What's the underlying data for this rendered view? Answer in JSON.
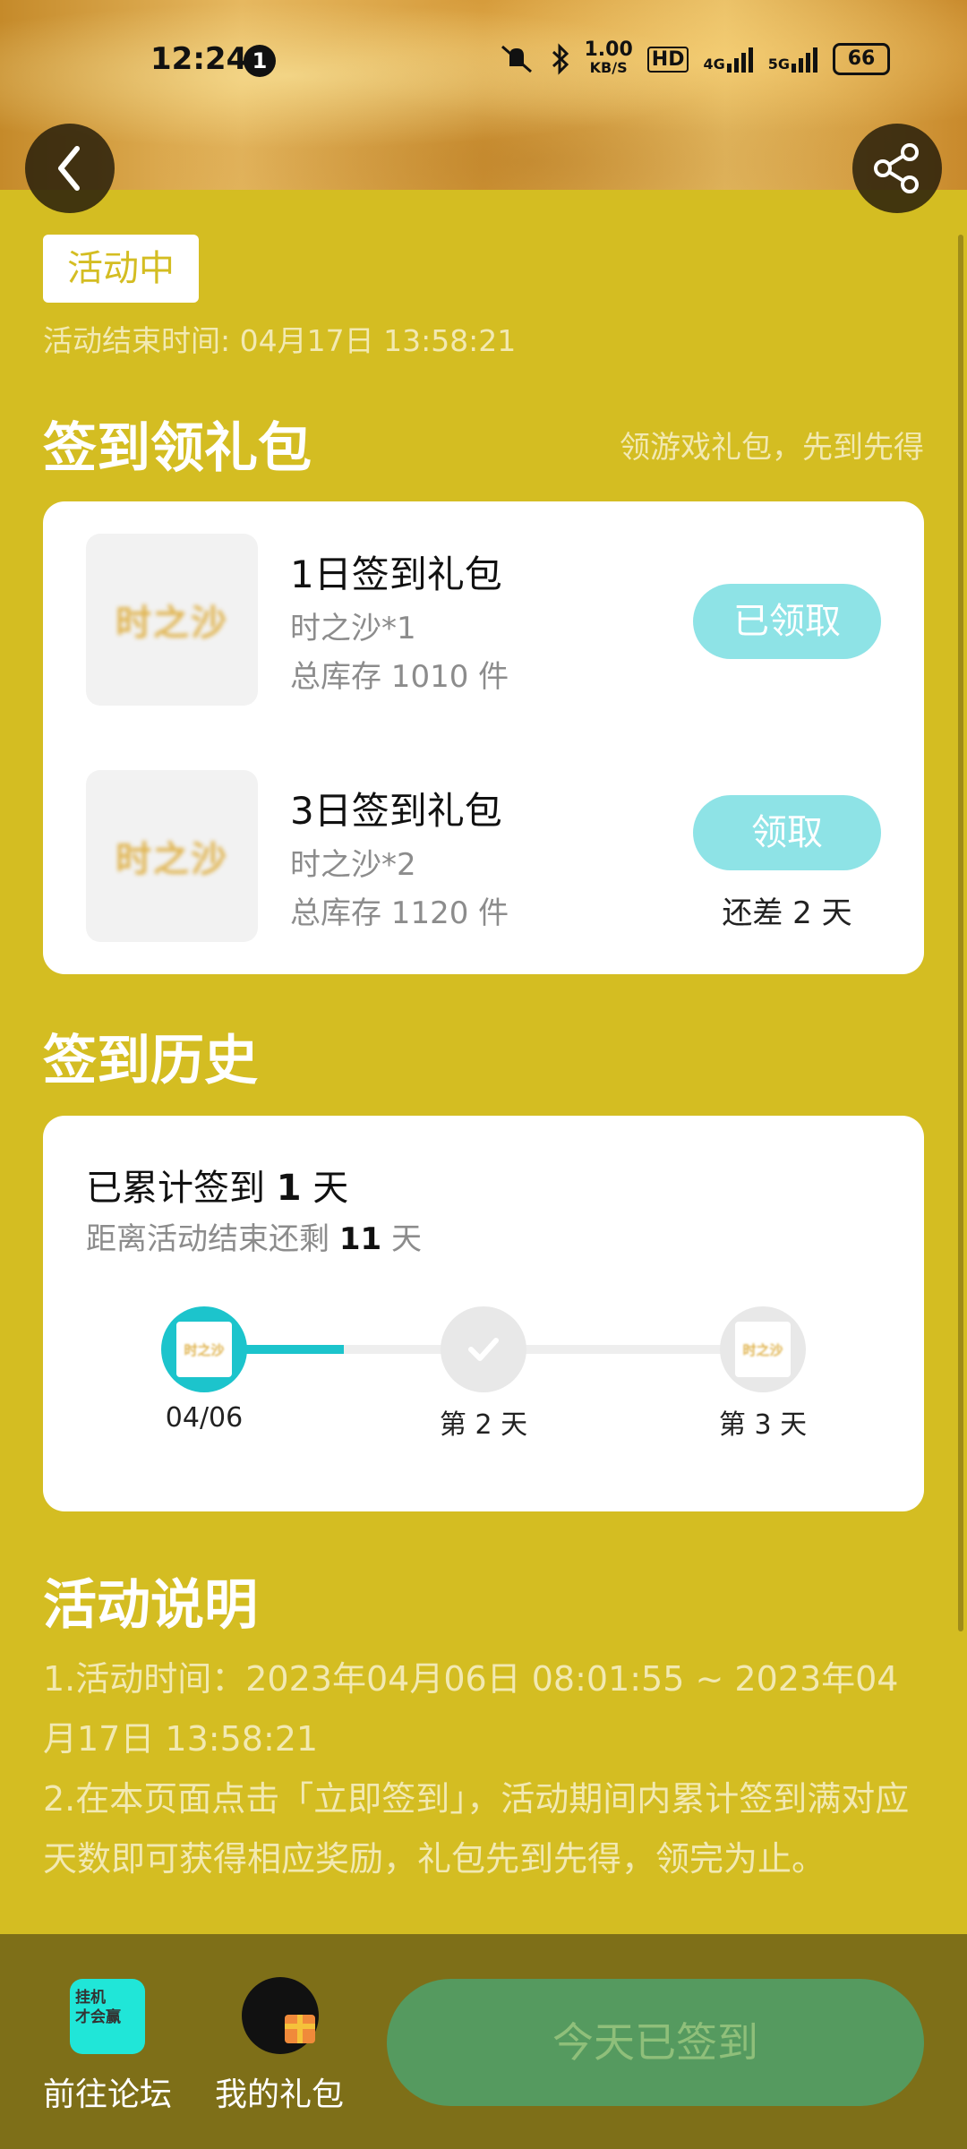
{
  "status_bar": {
    "time": "12:24",
    "notification_count": "1",
    "net_speed_value": "1.00",
    "net_speed_unit": "KB/S",
    "hd": "HD",
    "net_4g": "4G",
    "net_5g": "5G",
    "battery": "66"
  },
  "header": {
    "back_icon": "chevron-left-icon",
    "share_icon": "share-icon"
  },
  "activity": {
    "status_badge": "活动中",
    "end_time": "活动结束时间: 04月17日 13:58:21"
  },
  "gift_section": {
    "title": "签到领礼包",
    "subtitle": "领游戏礼包，先到先得",
    "items": [
      {
        "thumb_text": "时之沙",
        "name": "1日签到礼包",
        "content": "时之沙*1",
        "stock": "总库存 1010 件",
        "button": "已领取",
        "remain": ""
      },
      {
        "thumb_text": "时之沙",
        "name": "3日签到礼包",
        "content": "时之沙*2",
        "stock": "总库存 1120 件",
        "button": "领取",
        "remain": "还差 2 天"
      }
    ]
  },
  "history": {
    "title": "签到历史",
    "total_prefix": "已累计签到 ",
    "total_days": "1",
    "total_suffix": " 天",
    "left_prefix": "距离活动结束还剩 ",
    "left_days": "11",
    "left_suffix": " 天",
    "progress_fraction": 0.25,
    "nodes": [
      {
        "label": "04/06",
        "thumb_text": "时之沙"
      },
      {
        "label": "第 2 天"
      },
      {
        "label": "第 3 天",
        "thumb_text": "时之沙"
      }
    ]
  },
  "description": {
    "title": "活动说明",
    "line1": "1.活动时间：2023年04月06日 08:01:55 ~ 2023年04月17日 13:58:21",
    "line2": "2.在本页面点击「立即签到」，活动期间内累计签到满对应天数即可获得相应奖励，礼包先到先得，领完为止。"
  },
  "bottom_bar": {
    "forum_icon_text": "挂机\n才会赢",
    "forum_label": "前往论坛",
    "gift_label": "我的礼包",
    "signed_button": "今天已签到"
  },
  "colors": {
    "page_bg": "#d4bd22",
    "teal": "#1cc4cc",
    "pill": "#8ee3e6",
    "signed_btn": "#559a5f"
  }
}
